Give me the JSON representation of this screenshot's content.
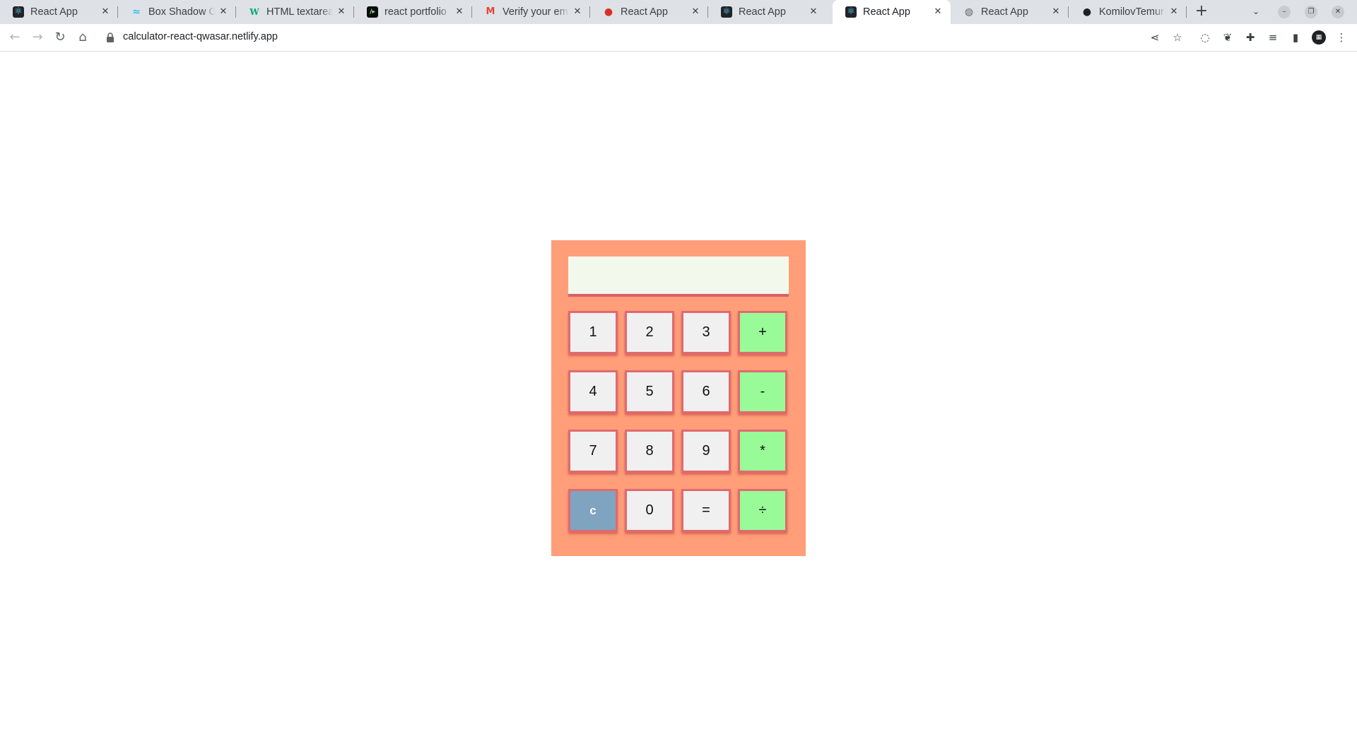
{
  "browser": {
    "tabs": [
      {
        "title": "React App",
        "favicon": "react-icon",
        "active": false
      },
      {
        "title": "Box Shadow CSS Generator",
        "favicon": "tailwind-icon",
        "active": false
      },
      {
        "title": "HTML textarea tag",
        "favicon": "w3schools-icon",
        "active": false
      },
      {
        "title": "react portfolio",
        "favicon": "devpost-icon",
        "active": false
      },
      {
        "title": "Verify your email",
        "favicon": "gmail-icon",
        "active": false
      },
      {
        "title": "React App",
        "favicon": "red-dot-icon",
        "active": false
      },
      {
        "title": "React App",
        "favicon": "react-icon",
        "active": false
      },
      {
        "title": "React App",
        "favicon": "react-icon",
        "active": true
      },
      {
        "title": "React App",
        "favicon": "globe-icon",
        "active": false
      },
      {
        "title": "KomilovTemur",
        "favicon": "github-icon",
        "active": false
      }
    ],
    "close_glyph": "✕",
    "newtab_glyph": "+",
    "url": "calculator-react-qwasar.netlify.app"
  },
  "calculator": {
    "display_value": "",
    "colors": {
      "body": "#ff9e79",
      "display": "#f2f8eb",
      "digit": "#f0f0f0",
      "operator": "#98fb98",
      "clear": "#7fa4bf",
      "border": "#e06a70"
    },
    "rows": [
      [
        {
          "label": "1",
          "kind": "digit"
        },
        {
          "label": "2",
          "kind": "digit"
        },
        {
          "label": "3",
          "kind": "digit"
        },
        {
          "label": "+",
          "kind": "op"
        }
      ],
      [
        {
          "label": "4",
          "kind": "digit"
        },
        {
          "label": "5",
          "kind": "digit"
        },
        {
          "label": "6",
          "kind": "digit"
        },
        {
          "label": "-",
          "kind": "op"
        }
      ],
      [
        {
          "label": "7",
          "kind": "digit"
        },
        {
          "label": "8",
          "kind": "digit"
        },
        {
          "label": "9",
          "kind": "digit"
        },
        {
          "label": "*",
          "kind": "op"
        }
      ],
      [
        {
          "label": "c",
          "kind": "clear"
        },
        {
          "label": "0",
          "kind": "digit"
        },
        {
          "label": "=",
          "kind": "digit"
        },
        {
          "label": "÷",
          "kind": "op"
        }
      ]
    ]
  }
}
